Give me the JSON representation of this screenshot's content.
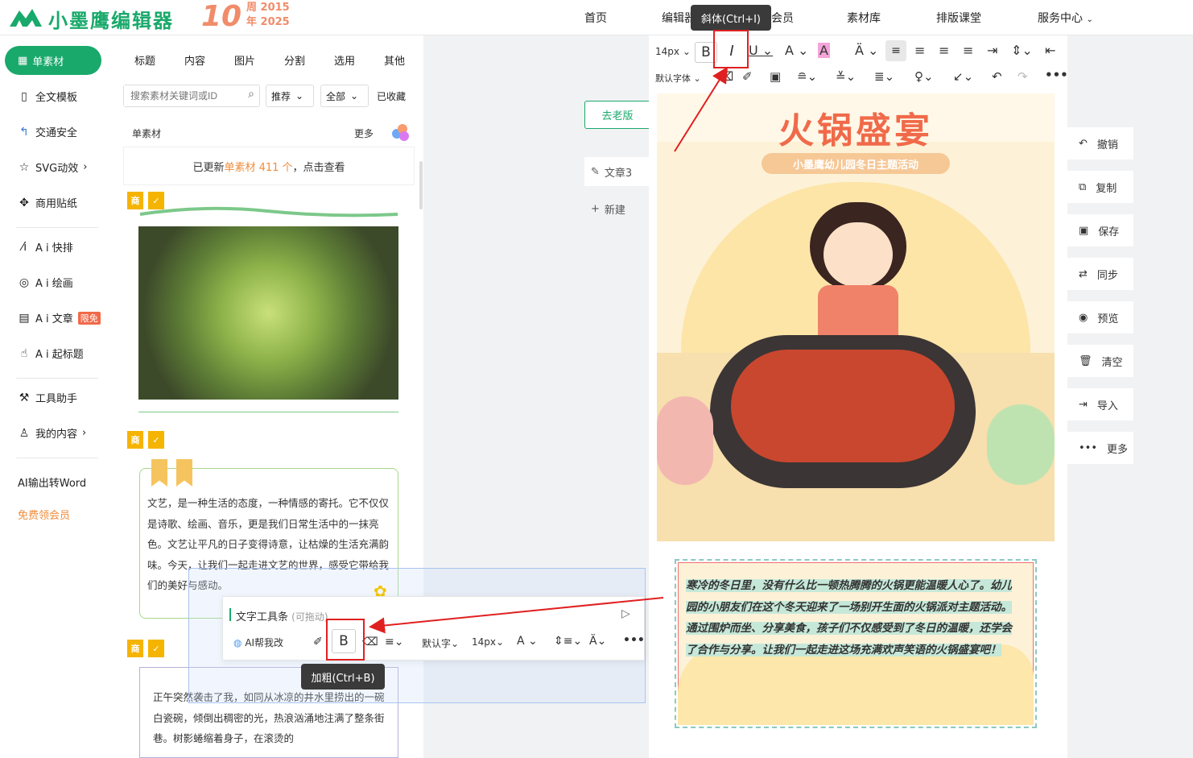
{
  "header": {
    "logo": "小墨鹰编辑器",
    "anniversary_num": "10",
    "anniversary_line1": "周 2015",
    "anniversary_line2": "年 2025",
    "nav": [
      "首页",
      "编辑器",
      "会员",
      "素材库",
      "排版课堂",
      "服务中心"
    ]
  },
  "sidebar": {
    "active": "单素材",
    "items": [
      "全文模板",
      "交通安全",
      "SVG动效",
      "商用贴纸",
      "A i 快排",
      "A i 绘画",
      "A i 文章",
      "A i 起标题",
      "工具助手",
      "我的内容",
      "AI输出转Word",
      "免费领会员"
    ],
    "free_badge": "限免"
  },
  "panel": {
    "tabs": [
      "标题",
      "内容",
      "图片",
      "分割",
      "选用",
      "其他"
    ],
    "search_placeholder": "搜索素材关键词或ID",
    "filter_recommend": "推荐",
    "filter_all": "全部",
    "favorites": "已收藏",
    "section_title": "单素材",
    "more": "更多",
    "update_prefix": "已更新 ",
    "update_highlight": "单素材 411 个",
    "update_suffix": "，点击查看",
    "badge_shang": "商",
    "card2_text": "文艺，是一种生活的态度，一种情感的寄托。它不仅仅是诗歌、绘画、音乐，更是我们日常生活中的一抹亮色。文艺让平凡的日子变得诗意，让枯燥的生活充满韵味。今天，让我们一起走进文艺的世界，感受它带给我们的美好与感动。",
    "card3_text": "正午突然袭击了我，如同从冰凉的井水里捞出的一碗白瓷碗，倾倒出稠密的光，热浪汹涌地注满了整条街巷。树影蜷缩着身子，在滚烫的"
  },
  "canvas": {
    "old_version": "去老版",
    "doc_name": "文章3",
    "new_doc": "新建"
  },
  "toolbar": {
    "font_size": "14px",
    "font_family": "默认字体",
    "italic_tooltip": "斜体(Ctrl+I)"
  },
  "poster": {
    "title": "火锅盛宴",
    "subtitle": "小墨鹰幼儿园冬日主题活动"
  },
  "body_text": "寒冷的冬日里，没有什么比一顿热腾腾的火锅更能温暖人心了。幼儿园的小朋友们在这个冬天迎来了一场别开生面的火锅派对主题活动。通过围炉而坐、分享美食，孩子们不仅感受到了冬日的温暖，还学会了合作与分享。让我们一起走进这场充满欢声笑语的火锅盛宴吧！",
  "right_actions": [
    "撤销",
    "复制",
    "保存",
    "同步",
    "预览",
    "清空",
    "导入",
    "更多"
  ],
  "float_toolbar": {
    "title": "文字工具条",
    "draggable": "(可拖动)",
    "ai_help": "AI帮我改",
    "font": "默认字",
    "size": "14px",
    "bold_tooltip": "加粗(Ctrl+B)"
  },
  "colors": {
    "brand": "#19a96b",
    "accent": "#f06a4a",
    "highlight_box": "#e02020"
  }
}
